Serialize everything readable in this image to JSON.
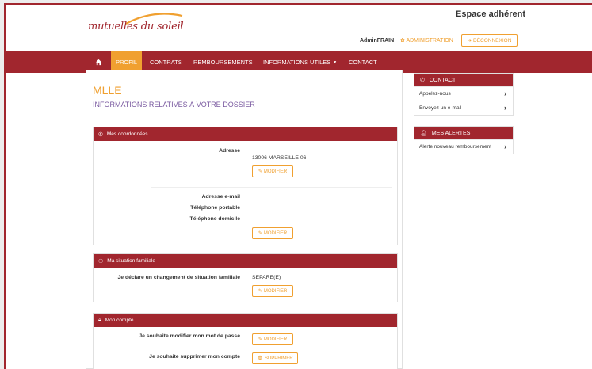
{
  "header": {
    "logo": "mutuelles du soleil",
    "espace": "Espace adhérent",
    "user": "AdminFRAIN",
    "admin": "ADMINISTRATION",
    "logout": "DÉCONNEXION",
    "admin_icon": "gear-icon",
    "logout_icon": "logout-icon"
  },
  "nav": {
    "home_icon": "home-icon",
    "items": [
      "PROFIL",
      "CONTRATS",
      "REMBOURSEMENTS",
      "INFORMATIONS UTILES",
      "CONTACT"
    ],
    "active": "PROFIL"
  },
  "main": {
    "civility": "MLLE",
    "subtitle": "INFORMATIONS RELATIVES À VOTRE DOSSIER",
    "coordonnees": {
      "title": "Mes coordonnées",
      "icon": "phone-icon",
      "address_label": "Adresse",
      "address_value": "13006 MARSEILLE 06",
      "email_label": "Adresse e-mail",
      "mobile_label": "Téléphone portable",
      "home_label": "Téléphone domicile",
      "modify": "MODIFIER"
    },
    "situation": {
      "title": "Ma situation familiale",
      "icon": "family-icon",
      "label": "Je déclare un changement de situation familiale",
      "value": "SEPARE(E)",
      "modify": "MODIFIER"
    },
    "compte": {
      "title": "Mon compte",
      "icon": "lock-icon",
      "password_label": "Je souhaite modifier mon mot de passe",
      "modify": "MODIFIER",
      "delete_label": "Je souhaite supprimer mon compte",
      "delete": "SUPPRIMER"
    }
  },
  "sidebar": {
    "contact": {
      "title": "CONTACT",
      "icon": "phone-icon",
      "items": [
        "Appelez-nous",
        "Envoyez un e-mail"
      ]
    },
    "alerts": {
      "title": "MES ALERTES",
      "icon": "bell-icon",
      "items": [
        "Alerte nouveau remboursement"
      ]
    }
  },
  "colors": {
    "brand": "#a1262e",
    "accent": "#f0a030",
    "subtitle": "#7a5aa0"
  }
}
